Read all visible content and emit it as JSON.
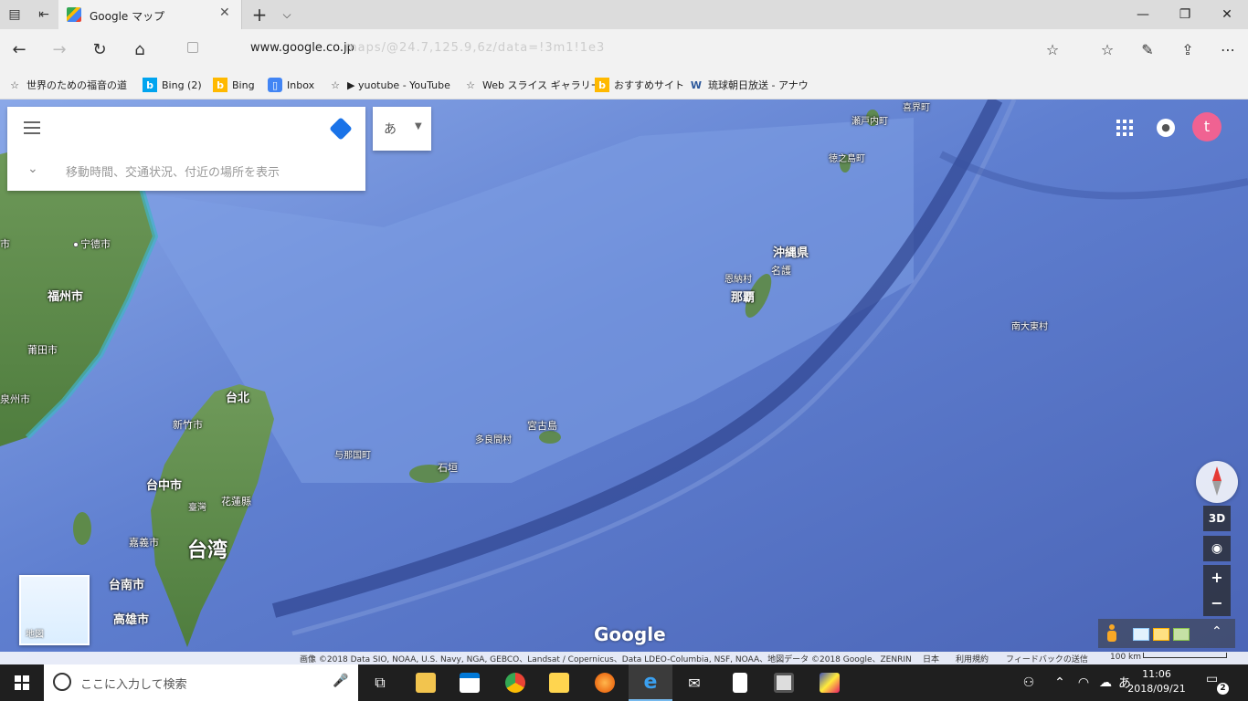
{
  "browser": {
    "tab_title": "Google マップ",
    "url_domain": "www.google.co.jp",
    "url_rest": "maps/@24.7,125.9,6z/data=!3m1!1e3",
    "favorites": [
      {
        "label": "世界のための福音の道",
        "icon": "star-icon"
      },
      {
        "label": "Bing (2)",
        "icon": "bing-icon"
      },
      {
        "label": "Bing",
        "icon": "bing-icon"
      },
      {
        "label": "Inbox",
        "icon": "inbox-icon"
      },
      {
        "label": "▶ yuotube - YouTube",
        "icon": "star-icon"
      },
      {
        "label": "Web スライス ギャラリー",
        "icon": "star-icon"
      },
      {
        "label": "おすすめサイト",
        "icon": "bing-icon"
      },
      {
        "label": "琉球朝日放送 - アナウ",
        "icon": "word-icon"
      }
    ]
  },
  "maps": {
    "search_placeholder": "",
    "hint": "移動時間、交通状況、付近の場所を表示",
    "ime_label": "あ",
    "avatar_letter": "t",
    "view_3d": "3D",
    "zoom_in": "+",
    "zoom_out": "−",
    "thumbnail_label": "地図",
    "google_logo": "Google",
    "labels": [
      {
        "text": "宁德市",
        "cls": "",
        "dot": true
      },
      {
        "text": "福州市",
        "cls": "big",
        "dot": true
      },
      {
        "text": "莆田市",
        "cls": "",
        "dot": true
      },
      {
        "text": "泉州市",
        "cls": "",
        "dot": false
      },
      {
        "text": "市",
        "cls": "",
        "dot": false
      },
      {
        "text": "台北",
        "cls": "big",
        "dot": true
      },
      {
        "text": "新竹市",
        "cls": "",
        "dot": true
      },
      {
        "text": "台中市",
        "cls": "big",
        "dot": true
      },
      {
        "text": "臺灣",
        "cls": "",
        "dot": false
      },
      {
        "text": "花蓮縣",
        "cls": "",
        "dot": true
      },
      {
        "text": "嘉義市",
        "cls": "",
        "dot": true
      },
      {
        "text": "台湾",
        "cls": "huge",
        "dot": false
      },
      {
        "text": "台南市",
        "cls": "big",
        "dot": true
      },
      {
        "text": "高雄市",
        "cls": "big",
        "dot": true
      },
      {
        "text": "与那国町",
        "cls": "",
        "dot": true
      },
      {
        "text": "石垣",
        "cls": "",
        "dot": true
      },
      {
        "text": "多良間村",
        "cls": "",
        "dot": true
      },
      {
        "text": "宮古島",
        "cls": "",
        "dot": true
      },
      {
        "text": "沖縄県",
        "cls": "big",
        "dot": false
      },
      {
        "text": "名護",
        "cls": "",
        "dot": true
      },
      {
        "text": "恩納村",
        "cls": "",
        "dot": true
      },
      {
        "text": "那覇",
        "cls": "big",
        "dot": true
      },
      {
        "text": "瀬戸内町",
        "cls": "",
        "dot": true
      },
      {
        "text": "徳之島町",
        "cls": "",
        "dot": true
      },
      {
        "text": "喜界町",
        "cls": "",
        "dot": false
      },
      {
        "text": "南大東村",
        "cls": "",
        "dot": true
      }
    ],
    "credits": {
      "imagery": "画像 ©2018 Data SIO, NOAA, U.S. Navy, NGA, GEBCO、Landsat / Copernicus、Data LDEO-Columbia, NSF, NOAA、地図データ ©2018 Google、ZENRIN",
      "country": "日本",
      "terms": "利用規約",
      "feedback": "フィードバックの送信",
      "scale": "100 km"
    }
  },
  "taskbar": {
    "search_placeholder": "ここに入力して検索",
    "time": "11:06",
    "date": "2018/09/21",
    "ime": "あ",
    "notifications": "2"
  }
}
